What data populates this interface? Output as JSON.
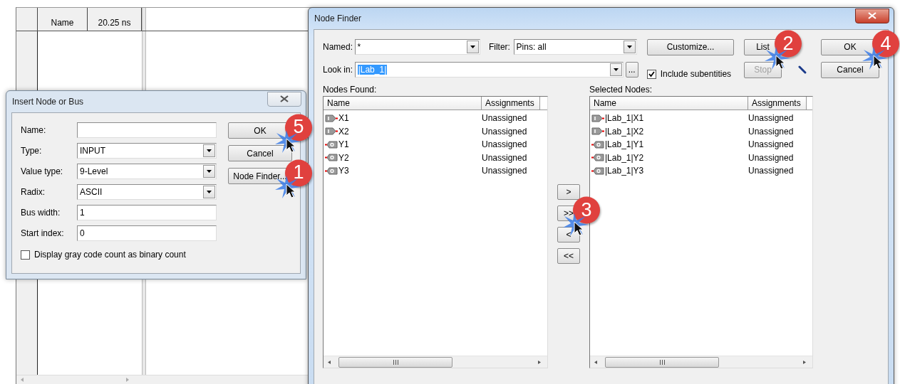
{
  "waveform_editor": {
    "columns": [
      {
        "label": "Name"
      },
      {
        "label": "20.25 ns"
      }
    ]
  },
  "insert_dialog": {
    "title": "Insert Node or Bus",
    "active": false,
    "fields": [
      {
        "kind": "text",
        "label": "Name:"
      },
      {
        "kind": "select",
        "label": "Type:",
        "value": "INPUT"
      },
      {
        "kind": "select",
        "label": "Value type:",
        "value": "9-Level"
      },
      {
        "kind": "select",
        "label": "Radix:",
        "value": "ASCII"
      },
      {
        "kind": "text",
        "label": "Bus width:",
        "value": "1"
      },
      {
        "kind": "text",
        "label": "Start index:",
        "value": "0"
      }
    ],
    "buttons": [
      {
        "label": "OK",
        "badge": "5"
      },
      {
        "label": "Cancel"
      },
      {
        "label": "Node Finder...",
        "badge": "1"
      }
    ],
    "checkbox": {
      "label": "Display gray code count as binary count",
      "checked": false
    }
  },
  "node_finder": {
    "title": "Node Finder",
    "active": true,
    "named": {
      "label": "Named:",
      "value": "*"
    },
    "filter": {
      "label": "Filter:",
      "value": "Pins: all"
    },
    "look_in": {
      "label": "Look in:",
      "value": "|Lab_1|",
      "selected": true
    },
    "browse": {
      "label": "..."
    },
    "include_subentities": {
      "label": "Include subentities",
      "checked": true
    },
    "customize": {
      "label": "Customize...",
      "disabled": false
    },
    "list": {
      "label": "List",
      "disabled": false,
      "badge": "2"
    },
    "stop": {
      "label": "Stop",
      "disabled": true
    },
    "ok": {
      "label": "OK",
      "disabled": false,
      "badge": "4"
    },
    "cancel": {
      "label": "Cancel",
      "disabled": false
    },
    "nodes_found": {
      "label": "Nodes Found:",
      "columns": [
        "Name",
        "Assignments"
      ],
      "rows": [
        {
          "kind": "input",
          "name": "X1",
          "assignment": "Unassigned"
        },
        {
          "kind": "input",
          "name": "X2",
          "assignment": "Unassigned"
        },
        {
          "kind": "output",
          "name": "Y1",
          "assignment": "Unassigned"
        },
        {
          "kind": "output",
          "name": "Y2",
          "assignment": "Unassigned"
        },
        {
          "kind": "output",
          "name": "Y3",
          "assignment": "Unassigned"
        }
      ]
    },
    "transfer_buttons": [
      {
        "label": ">"
      },
      {
        "label": ">>",
        "badge": "3"
      },
      {
        "label": "<"
      },
      {
        "label": "<<"
      }
    ],
    "selected_nodes": {
      "label": "Selected Nodes:",
      "columns": [
        "Name",
        "Assignments"
      ],
      "rows": [
        {
          "kind": "input",
          "name": "|Lab_1|X1",
          "assignment": "Unassigned"
        },
        {
          "kind": "input",
          "name": "|Lab_1|X2",
          "assignment": "Unassigned"
        },
        {
          "kind": "output",
          "name": "|Lab_1|Y1",
          "assignment": "Unassigned"
        },
        {
          "kind": "output",
          "name": "|Lab_1|Y2",
          "assignment": "Unassigned"
        },
        {
          "kind": "output",
          "name": "|Lab_1|Y3",
          "assignment": "Unassigned"
        }
      ]
    }
  }
}
